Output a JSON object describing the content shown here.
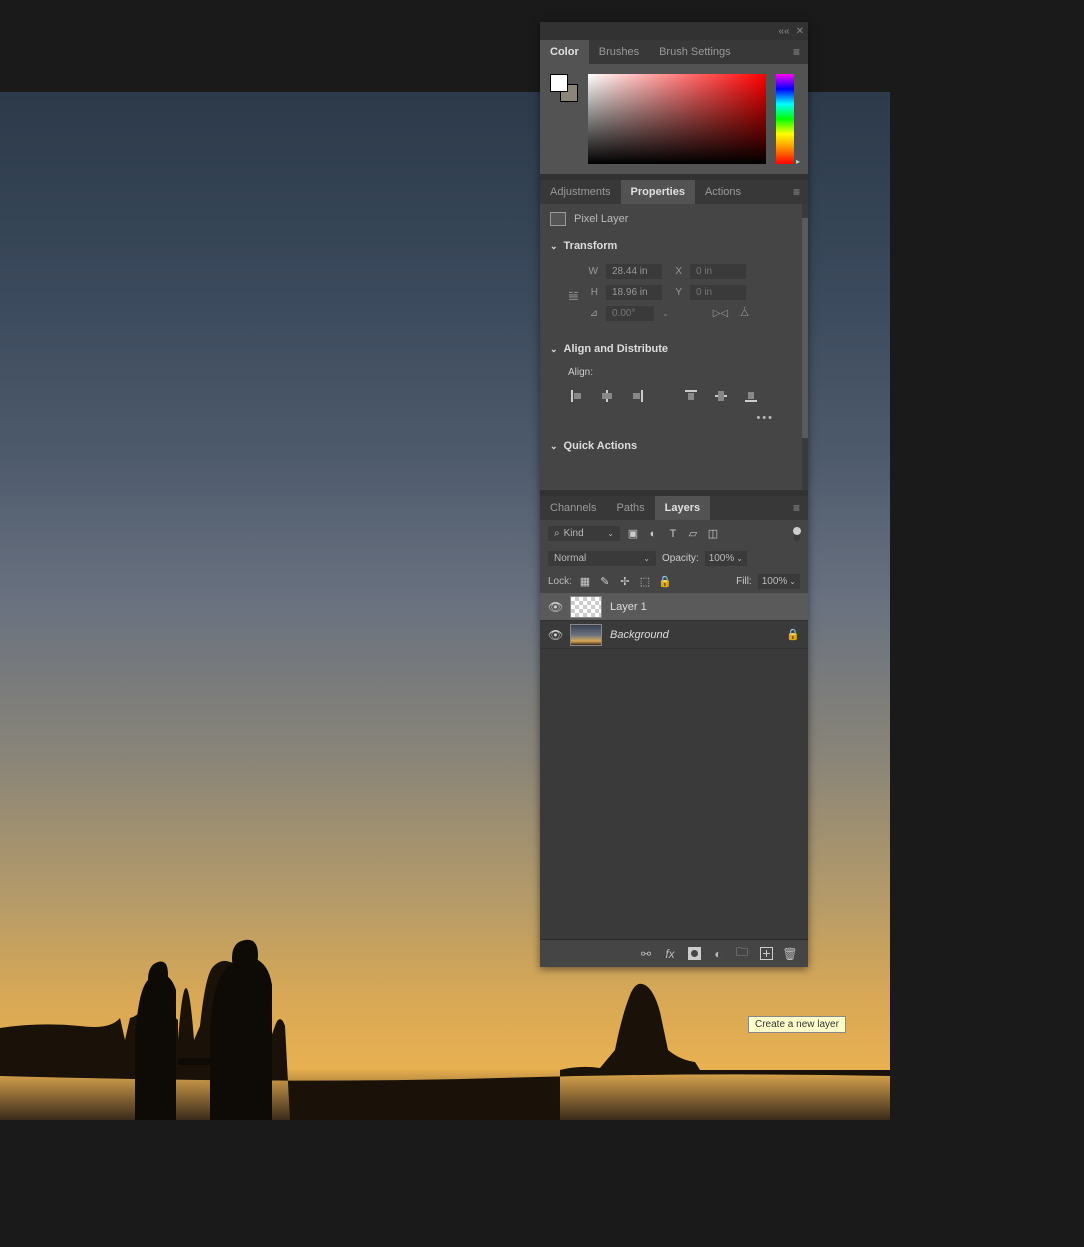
{
  "panels": {
    "color": {
      "tabs": [
        "Color",
        "Brushes",
        "Brush Settings"
      ],
      "active_tab": "Color",
      "fg_color": "#ffffff",
      "bg_color": "#8a8576"
    },
    "properties": {
      "tabs": [
        "Adjustments",
        "Properties",
        "Actions"
      ],
      "active_tab": "Properties",
      "layer_type": "Pixel Layer",
      "sections": {
        "transform": {
          "title": "Transform",
          "w_label": "W",
          "w_value": "28.44 in",
          "h_label": "H",
          "h_value": "18.96 in",
          "x_label": "X",
          "x_value": "0 in",
          "y_label": "Y",
          "y_value": "0 in",
          "angle_value": "0.00°"
        },
        "align": {
          "title": "Align and Distribute",
          "subtitle": "Align:"
        },
        "quick_actions": {
          "title": "Quick Actions"
        }
      }
    },
    "layers": {
      "tabs": [
        "Channels",
        "Paths",
        "Layers"
      ],
      "active_tab": "Layers",
      "kind_label": "Kind",
      "blend_mode": "Normal",
      "opacity_label": "Opacity:",
      "opacity_value": "100%",
      "lock_label": "Lock:",
      "fill_label": "Fill:",
      "fill_value": "100%",
      "items": [
        {
          "name": "Layer 1",
          "visible": true,
          "locked": false,
          "selected": true,
          "thumb": "transparent"
        },
        {
          "name": "Background",
          "visible": true,
          "locked": true,
          "selected": false,
          "thumb": "image",
          "italic": true
        }
      ],
      "footer_icons": [
        "link",
        "fx",
        "mask",
        "adjustment",
        "group",
        "new-layer",
        "delete"
      ]
    }
  },
  "tooltip": "Create a new layer"
}
